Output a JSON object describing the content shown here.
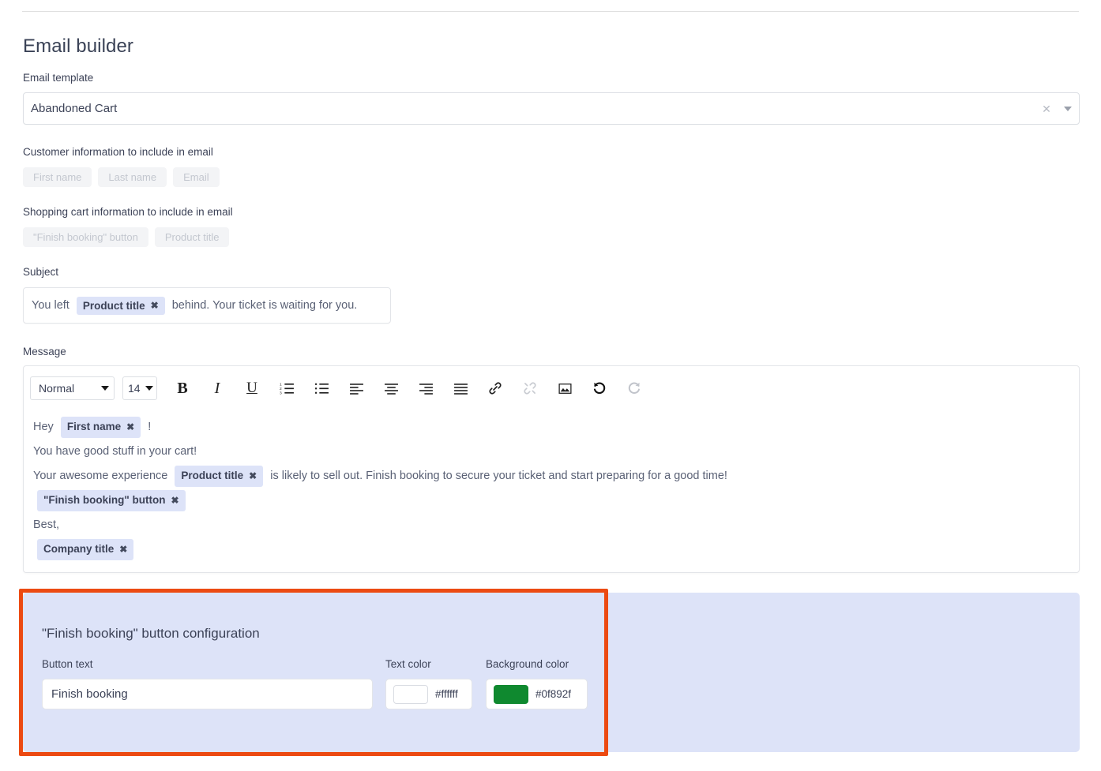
{
  "page": {
    "title": "Email builder"
  },
  "template": {
    "label": "Email template",
    "value": "Abandoned Cart",
    "clear_icon": "close-icon",
    "caret_icon": "chevron-down-icon"
  },
  "customer_info": {
    "label": "Customer information to include in email",
    "chips": [
      "First name",
      "Last name",
      "Email"
    ]
  },
  "cart_info": {
    "label": "Shopping cart information to include in email",
    "chips": [
      "\"Finish booking\" button",
      "Product title"
    ]
  },
  "subject": {
    "label": "Subject",
    "prefix": "You left ",
    "token": "Product title",
    "token_remove": "✖",
    "suffix": " behind. Your ticket is waiting for you."
  },
  "message": {
    "label": "Message",
    "toolbar": {
      "block_format": "Normal",
      "font_size": "14",
      "bold": "B",
      "italic": "I",
      "underline": "U",
      "ordered_list": "ordered-list-icon",
      "bullet_list": "bullet-list-icon",
      "align_left": "align-left-icon",
      "align_center": "align-center-icon",
      "align_right": "align-right-icon",
      "align_justify": "align-justify-icon",
      "link": "link-icon",
      "unlink": "unlink-icon",
      "image": "image-icon",
      "undo": "undo-icon",
      "redo": "redo-icon"
    },
    "body": {
      "l1_pre": "Hey ",
      "l1_token": "First name",
      "l1_post": " !",
      "l2": "You have good stuff in your cart!",
      "l3_pre": "Your awesome experience ",
      "l3_token": "Product title",
      "l3_post": " is likely to sell out. Finish booking to secure your ticket and start preparing for a good time!",
      "l4_token": "\"Finish booking\" button",
      "l5": "Best,",
      "l6_token": "Company title",
      "token_remove": "✖"
    }
  },
  "button_config": {
    "title": "\"Finish booking\" button configuration",
    "button_text_label": "Button text",
    "button_text_value": "Finish booking",
    "text_color_label": "Text color",
    "text_color_value": "#ffffff",
    "bg_color_label": "Background color",
    "bg_color_value": "#0f892f"
  },
  "colors": {
    "token_bg": "#dde3f8",
    "panel_bg": "#dde3f8",
    "highlight_border": "#ec4a12",
    "text_swatch": "#ffffff",
    "bg_swatch": "#0f892f"
  }
}
